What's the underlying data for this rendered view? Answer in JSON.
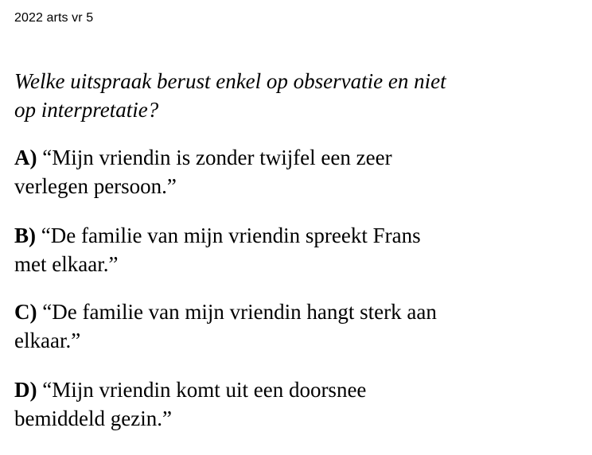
{
  "header": {
    "label": "2022 arts vr 5"
  },
  "question": {
    "line1": "Welke uitspraak berust enkel op observatie en niet",
    "line2": "op interpretatie?"
  },
  "options": [
    {
      "letter": "A)",
      "line1": " “Mijn vriendin is zonder twijfel een zeer",
      "line2": "verlegen persoon.”"
    },
    {
      "letter": "B)",
      "line1": " “De familie van mijn vriendin spreekt Frans",
      "line2": "met elkaar.”"
    },
    {
      "letter": "C)",
      "line1": " “De familie van mijn vriendin hangt sterk aan",
      "line2": "elkaar.”"
    },
    {
      "letter": "D)",
      "line1": " “Mijn vriendin komt uit een doorsnee",
      "line2": "bemiddeld gezin.”"
    }
  ]
}
